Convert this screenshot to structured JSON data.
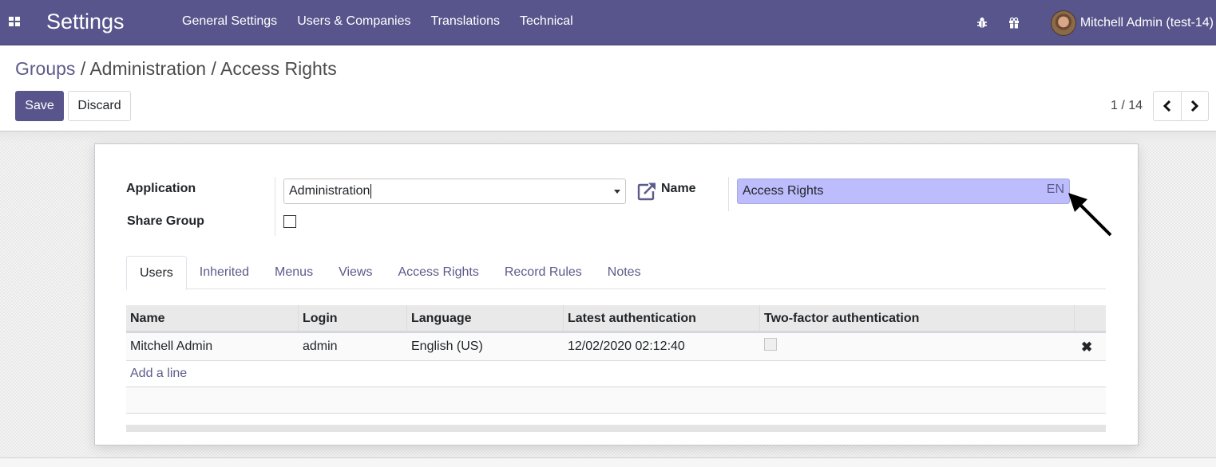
{
  "navbar": {
    "app_title": "Settings",
    "menu": [
      "General Settings",
      "Users & Companies",
      "Translations",
      "Technical"
    ],
    "user_name": "Mitchell Admin (test-14)",
    "color": "#58558c",
    "icons": [
      "apps-grid-icon",
      "bug-icon",
      "gift-icon"
    ]
  },
  "breadcrumb": {
    "link": "Groups",
    "separator1": " / ",
    "middle": "Administration",
    "separator2": " / ",
    "current": "Access Rights"
  },
  "toolbar": {
    "save_label": "Save",
    "discard_label": "Discard"
  },
  "pager": {
    "value": "1 / 14",
    "prev_icon": "chevron-left-icon",
    "next_icon": "chevron-right-icon"
  },
  "form": {
    "application_label": "Application",
    "application_value": "Administration",
    "share_group_label": "Share Group",
    "share_group_checked": false,
    "name_label": "Name",
    "name_value": "Access Rights",
    "name_lang": "EN",
    "highlight_color": "#bdbcfc"
  },
  "tabs": [
    {
      "label": "Users",
      "active": true
    },
    {
      "label": "Inherited",
      "active": false
    },
    {
      "label": "Menus",
      "active": false
    },
    {
      "label": "Views",
      "active": false
    },
    {
      "label": "Access Rights",
      "active": false
    },
    {
      "label": "Record Rules",
      "active": false
    },
    {
      "label": "Notes",
      "active": false
    }
  ],
  "users_table": {
    "columns": [
      "Name",
      "Login",
      "Language",
      "Latest authentication",
      "Two-factor authentication",
      ""
    ],
    "rows": [
      {
        "name": "Mitchell Admin",
        "login": "admin",
        "language": "English (US)",
        "latest_auth": "12/02/2020 02:12:40",
        "two_factor": false,
        "delete_icon": "✖"
      }
    ],
    "add_line": "Add a line"
  }
}
